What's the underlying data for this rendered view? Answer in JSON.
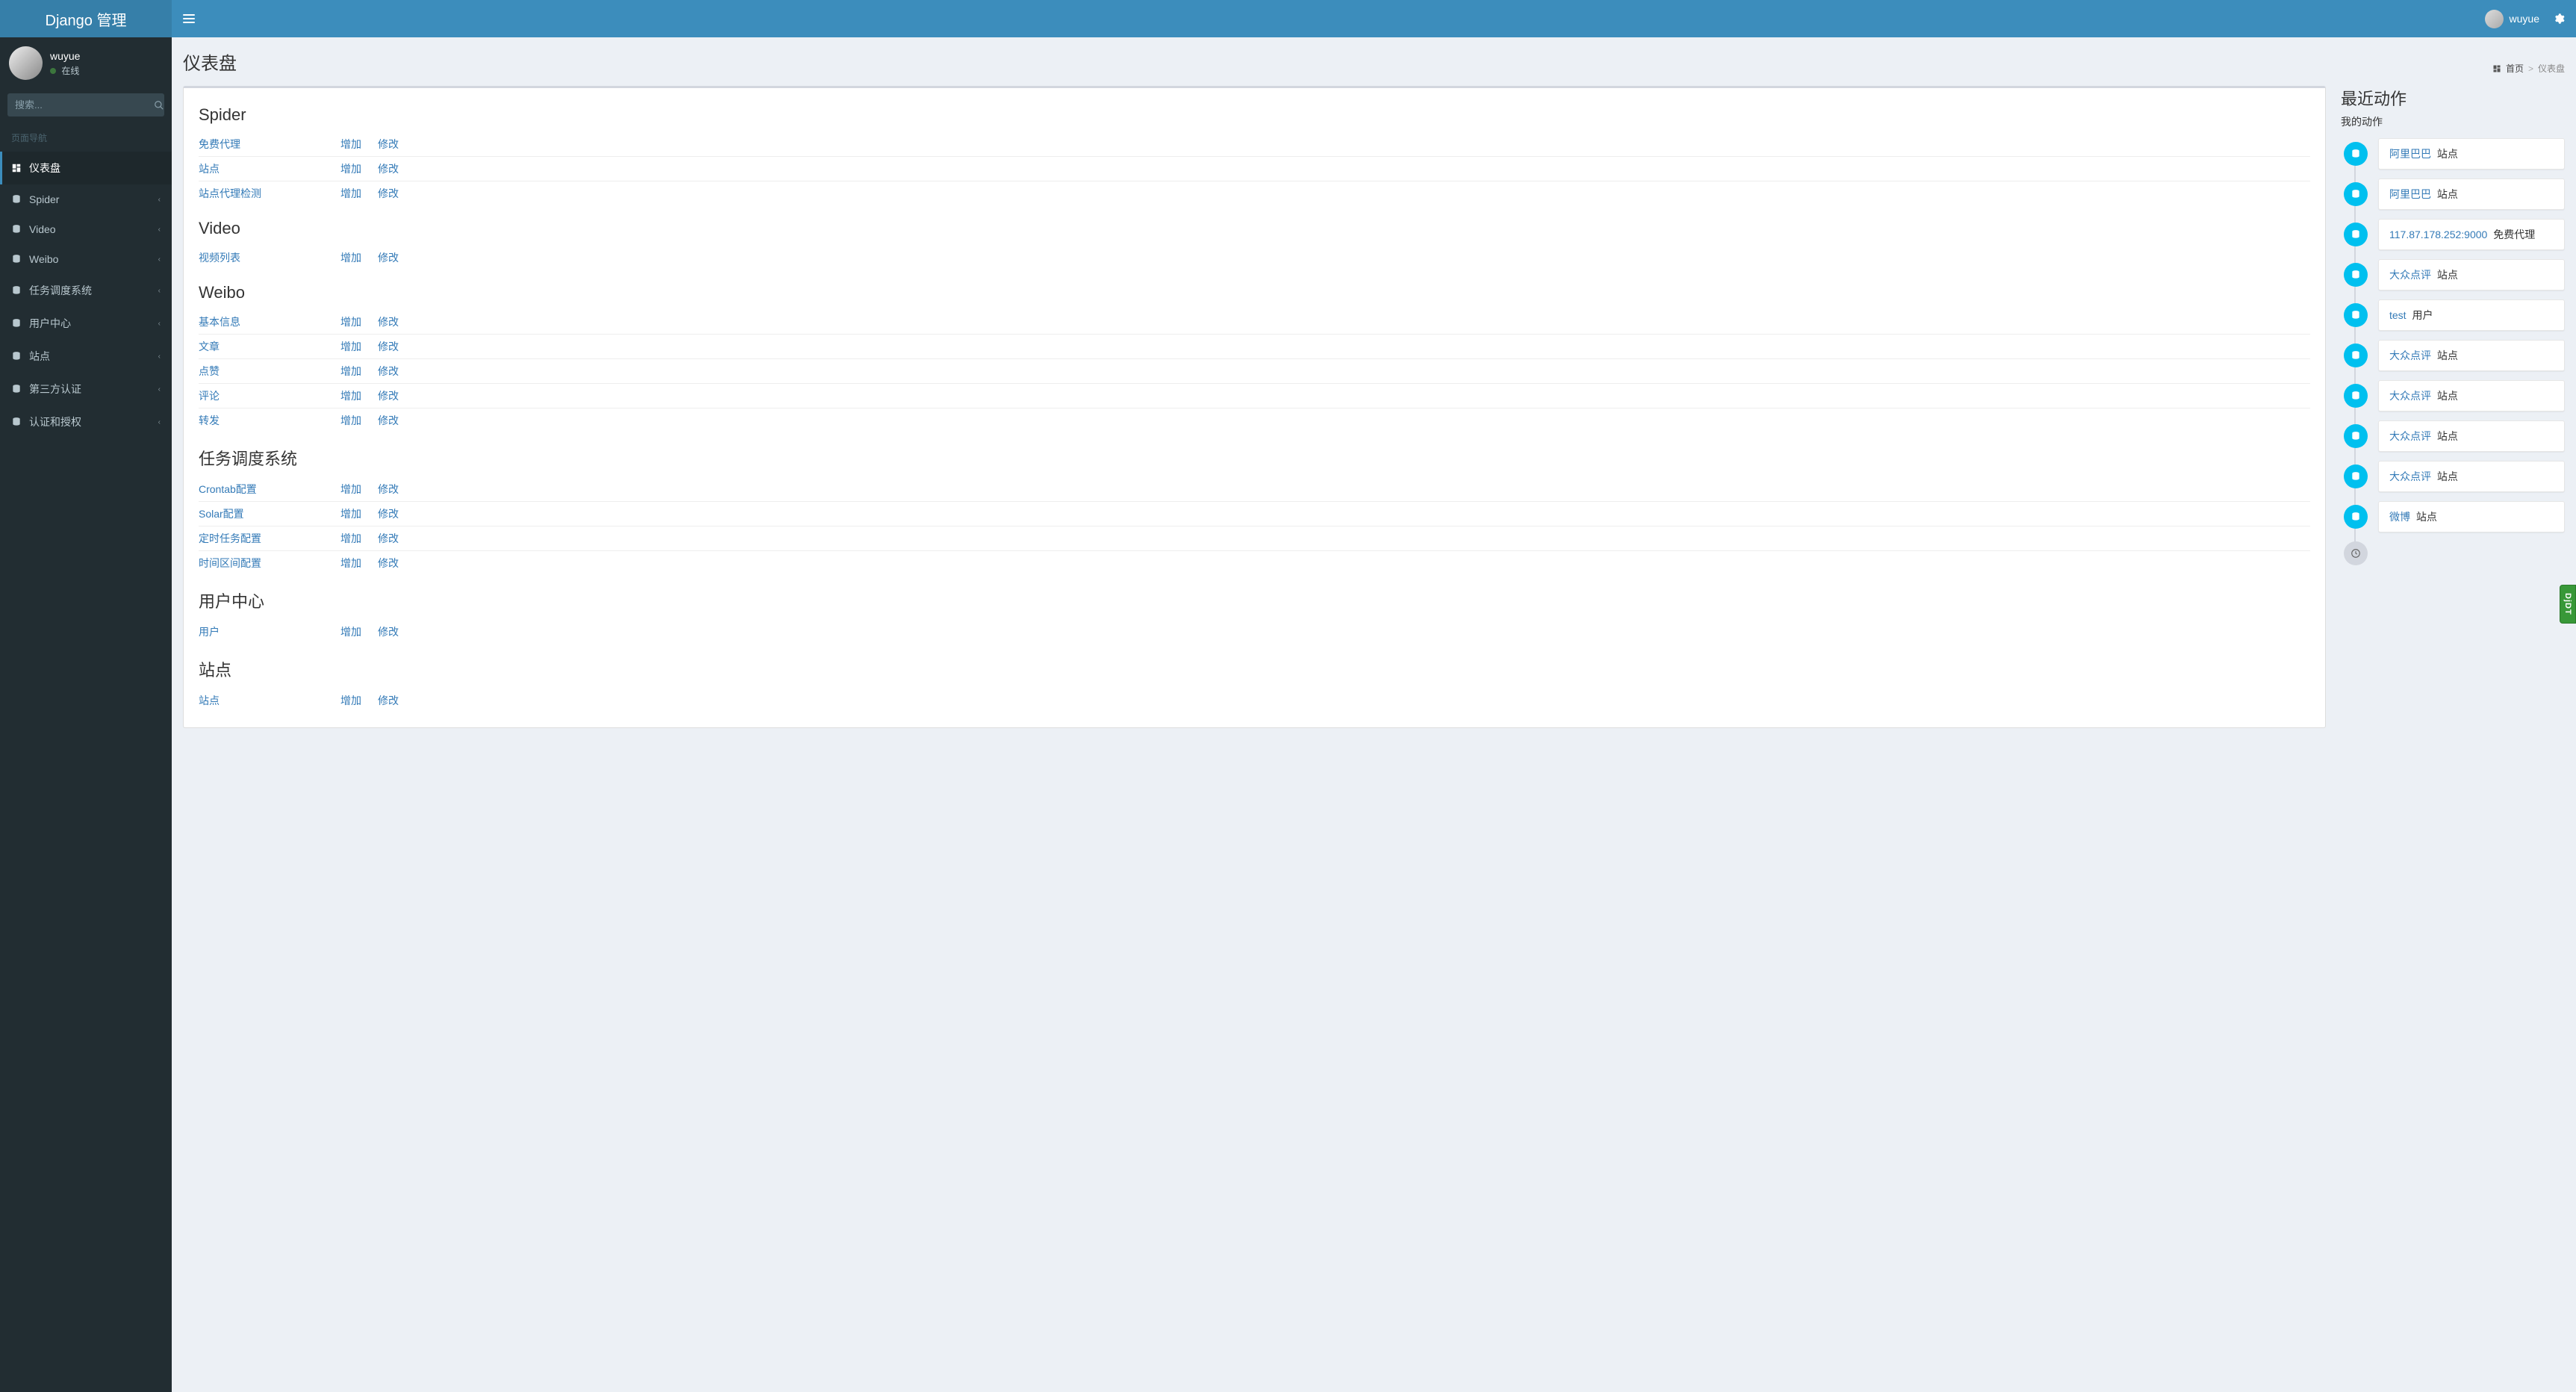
{
  "brand": "Django 管理",
  "user": {
    "name": "wuyue",
    "status": "在线"
  },
  "search": {
    "placeholder": "搜索..."
  },
  "nav": {
    "header": "页面导航",
    "items": [
      {
        "label": "仪表盘",
        "icon": "dashboard",
        "active": true,
        "expandable": false
      },
      {
        "label": "Spider",
        "icon": "db",
        "active": false,
        "expandable": true
      },
      {
        "label": "Video",
        "icon": "db",
        "active": false,
        "expandable": true
      },
      {
        "label": "Weibo",
        "icon": "db",
        "active": false,
        "expandable": true
      },
      {
        "label": "任务调度系统",
        "icon": "db",
        "active": false,
        "expandable": true
      },
      {
        "label": "用户中心",
        "icon": "db",
        "active": false,
        "expandable": true
      },
      {
        "label": "站点",
        "icon": "db",
        "active": false,
        "expandable": true
      },
      {
        "label": "第三方认证",
        "icon": "db",
        "active": false,
        "expandable": true
      },
      {
        "label": "认证和授权",
        "icon": "db",
        "active": false,
        "expandable": true
      }
    ]
  },
  "page": {
    "title": "仪表盘",
    "breadcrumb": {
      "home": "首页",
      "current": "仪表盘"
    }
  },
  "actions": {
    "add": "增加",
    "change": "修改"
  },
  "apps": [
    {
      "name": "Spider",
      "models": [
        "免费代理",
        "站点",
        "站点代理检测"
      ]
    },
    {
      "name": "Video",
      "models": [
        "视频列表"
      ]
    },
    {
      "name": "Weibo",
      "models": [
        "基本信息",
        "文章",
        "点赞",
        "评论",
        "转发"
      ]
    },
    {
      "name": "任务调度系统",
      "models": [
        "Crontab配置",
        "Solar配置",
        "定时任务配置",
        "时间区间配置"
      ]
    },
    {
      "name": "用户中心",
      "models": [
        "用户"
      ]
    },
    {
      "name": "站点",
      "models": [
        "站点"
      ]
    }
  ],
  "recent": {
    "title": "最近动作",
    "subtitle": "我的动作",
    "items": [
      {
        "link": "阿里巴巴",
        "suffix": "站点",
        "badge": "db"
      },
      {
        "link": "阿里巴巴",
        "suffix": "站点",
        "badge": "db"
      },
      {
        "link": "117.87.178.252:9000",
        "suffix": "免费代理",
        "badge": "db"
      },
      {
        "link": "大众点评",
        "suffix": "站点",
        "badge": "db"
      },
      {
        "link": "test",
        "suffix": "用户",
        "badge": "db"
      },
      {
        "link": "大众点评",
        "suffix": "站点",
        "badge": "db"
      },
      {
        "link": "大众点评",
        "suffix": "站点",
        "badge": "db"
      },
      {
        "link": "大众点评",
        "suffix": "站点",
        "badge": "db"
      },
      {
        "link": "大众点评",
        "suffix": "站点",
        "badge": "db"
      },
      {
        "link": "微博",
        "suffix": "站点",
        "badge": "db"
      }
    ]
  },
  "djdt": "DjDT"
}
